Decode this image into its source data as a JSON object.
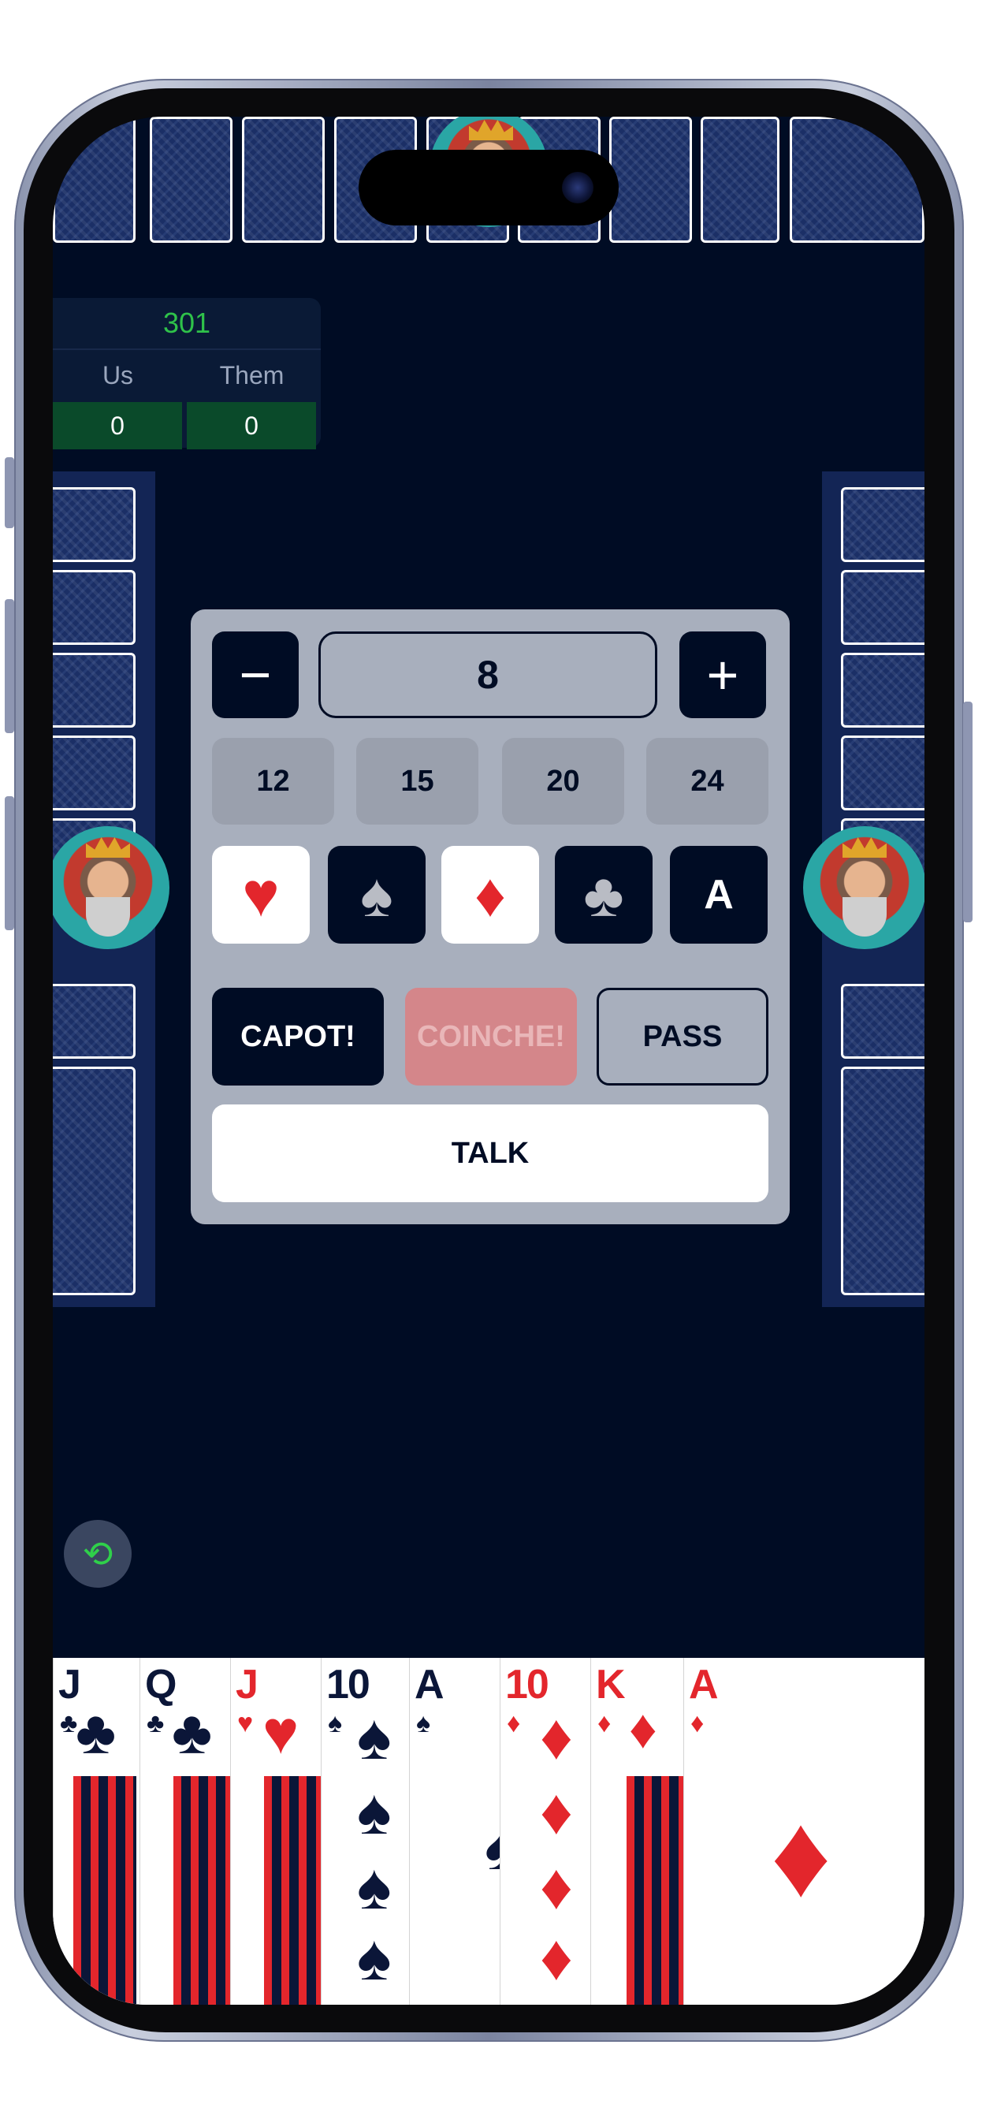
{
  "score": {
    "target": "301",
    "headers": [
      "Us",
      "Them"
    ],
    "values": [
      "0",
      "0"
    ]
  },
  "bid": {
    "minus_label": "−",
    "plus_label": "+",
    "value": "8",
    "presets": [
      "12",
      "15",
      "20",
      "24"
    ],
    "suits": [
      {
        "symbol": "♥",
        "name": "hearts"
      },
      {
        "symbol": "♠",
        "name": "spades"
      },
      {
        "symbol": "♦",
        "name": "diamonds"
      },
      {
        "symbol": "♣",
        "name": "clubs"
      },
      {
        "symbol": "A",
        "name": "all-trumps"
      }
    ],
    "capot_label": "CAPOT!",
    "coinche_label": "COINCHE!",
    "pass_label": "PASS",
    "talk_label": "TALK"
  },
  "hand": [
    {
      "rank": "J",
      "suit": "♣",
      "color": "#0b1638"
    },
    {
      "rank": "Q",
      "suit": "♣",
      "color": "#0b1638"
    },
    {
      "rank": "J",
      "suit": "♥",
      "color": "#e3262c"
    },
    {
      "rank": "10",
      "suit": "♠",
      "color": "#0b1638"
    },
    {
      "rank": "A",
      "suit": "♠",
      "color": "#0b1638"
    },
    {
      "rank": "10",
      "suit": "♦",
      "color": "#e3262c"
    },
    {
      "rank": "K",
      "suit": "♦",
      "color": "#e3262c"
    },
    {
      "rank": "A",
      "suit": "♦",
      "color": "#e3262c"
    }
  ],
  "chat_icon": "chat-swap-icon",
  "colors": {
    "table": "#000c24",
    "panel": "#a8afbd",
    "accent_green": "#2fc24a",
    "coinche_disabled": "#d4868a",
    "card_red": "#e3262c",
    "card_dark": "#0b1638"
  }
}
